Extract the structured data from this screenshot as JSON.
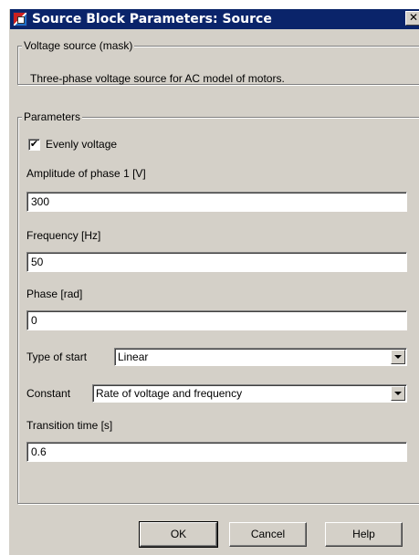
{
  "window": {
    "title": "Source Block Parameters: Source",
    "close_glyph": "✕"
  },
  "mask_group": {
    "legend": "Voltage source  (mask)",
    "description": "Three-phase voltage source for AC model of motors."
  },
  "params_group": {
    "legend": "Parameters",
    "evenly_voltage": {
      "label": "Evenly voltage",
      "checked": true,
      "mark": "✔"
    },
    "amplitude": {
      "label": "Amplitude of phase 1 [V]",
      "value": "300"
    },
    "frequency": {
      "label": "Frequency [Hz]",
      "value": "50"
    },
    "phase": {
      "label": "Phase  [rad]",
      "value": "0"
    },
    "type_of_start": {
      "label": "Type of start",
      "selected": "Linear"
    },
    "constant": {
      "label": "Constant",
      "selected": "Rate of voltage and frequency"
    },
    "transition_time": {
      "label": "Transition time  [s]",
      "value": "0.6"
    }
  },
  "buttons": {
    "ok": "OK",
    "cancel": "Cancel",
    "help": "Help"
  },
  "colors": {
    "titlebar": "#0a246a",
    "dialog_face": "#d4d0c8"
  },
  "icons": [
    "simulink-block-icon",
    "close-icon",
    "checkmark-icon",
    "chevron-down-icon"
  ]
}
